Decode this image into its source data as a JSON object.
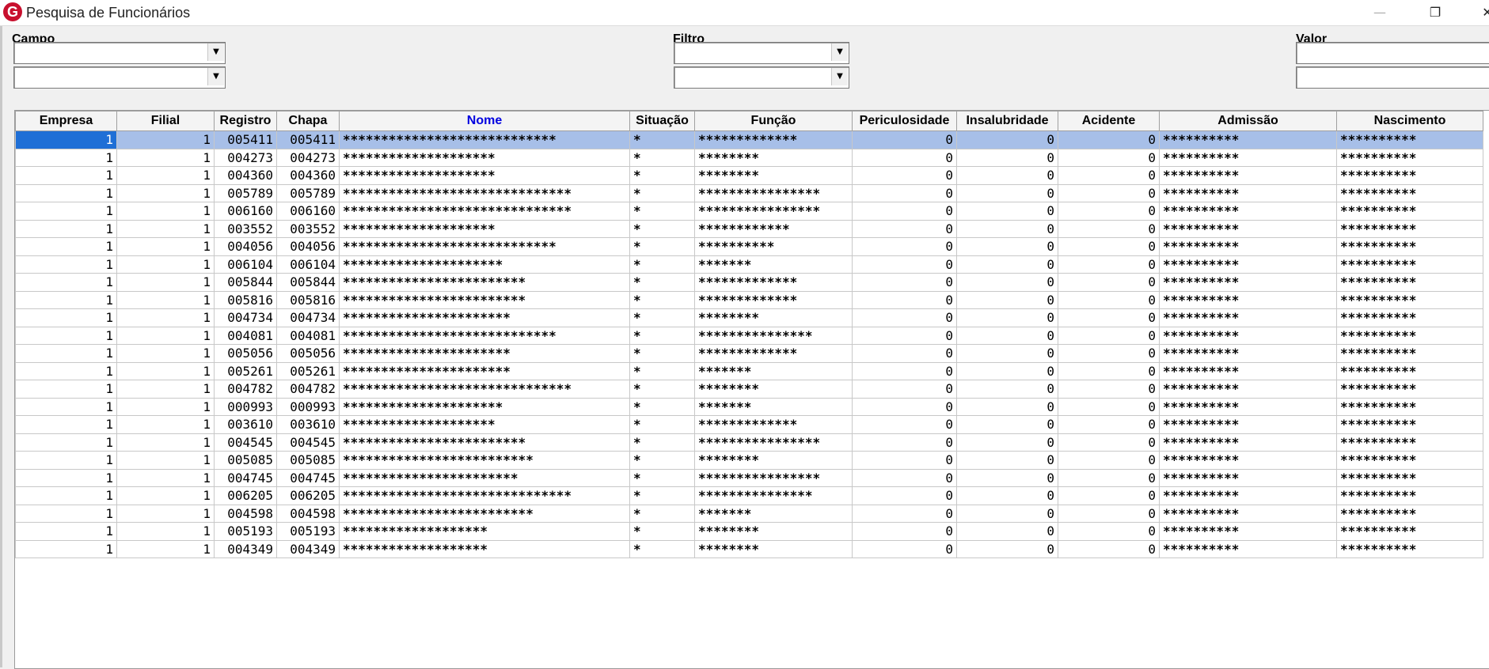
{
  "window": {
    "title": "Pesquisa de Funcionários",
    "logo_letter": "G"
  },
  "filters": {
    "campo_label": "Campo",
    "filtro_label": "Filtro",
    "valor_label": "Valor",
    "campo1_value": "",
    "campo2_value": "",
    "filtro1_value": "",
    "filtro2_value": "",
    "valor1_value": "",
    "valor2_value": ""
  },
  "table": {
    "columns": [
      "Empresa",
      "Filial",
      "Registro",
      "Chapa",
      "Nome",
      "Situação",
      "Função",
      "Periculosidade",
      "Insalubridade",
      "Acidente",
      "Admissão",
      "Nascimento"
    ],
    "sorted_column": "Nome",
    "selected_row": 0,
    "rows": [
      [
        "1",
        "1",
        "005411",
        "005411",
        "****************************",
        "*",
        "*************",
        "0",
        "0",
        "0",
        "**********",
        "**********"
      ],
      [
        "1",
        "1",
        "004273",
        "004273",
        "********************",
        "*",
        "********",
        "0",
        "0",
        "0",
        "**********",
        "**********"
      ],
      [
        "1",
        "1",
        "004360",
        "004360",
        "********************",
        "*",
        "********",
        "0",
        "0",
        "0",
        "**********",
        "**********"
      ],
      [
        "1",
        "1",
        "005789",
        "005789",
        "******************************",
        "*",
        "****************",
        "0",
        "0",
        "0",
        "**********",
        "**********"
      ],
      [
        "1",
        "1",
        "006160",
        "006160",
        "******************************",
        "*",
        "****************",
        "0",
        "0",
        "0",
        "**********",
        "**********"
      ],
      [
        "1",
        "1",
        "003552",
        "003552",
        "********************",
        "*",
        "************",
        "0",
        "0",
        "0",
        "**********",
        "**********"
      ],
      [
        "1",
        "1",
        "004056",
        "004056",
        "****************************",
        "*",
        "**********",
        "0",
        "0",
        "0",
        "**********",
        "**********"
      ],
      [
        "1",
        "1",
        "006104",
        "006104",
        "*********************",
        "*",
        "*******",
        "0",
        "0",
        "0",
        "**********",
        "**********"
      ],
      [
        "1",
        "1",
        "005844",
        "005844",
        "************************",
        "*",
        "*************",
        "0",
        "0",
        "0",
        "**********",
        "**********"
      ],
      [
        "1",
        "1",
        "005816",
        "005816",
        "************************",
        "*",
        "*************",
        "0",
        "0",
        "0",
        "**********",
        "**********"
      ],
      [
        "1",
        "1",
        "004734",
        "004734",
        "**********************",
        "*",
        "********",
        "0",
        "0",
        "0",
        "**********",
        "**********"
      ],
      [
        "1",
        "1",
        "004081",
        "004081",
        "****************************",
        "*",
        "***************",
        "0",
        "0",
        "0",
        "**********",
        "**********"
      ],
      [
        "1",
        "1",
        "005056",
        "005056",
        "**********************",
        "*",
        "*************",
        "0",
        "0",
        "0",
        "**********",
        "**********"
      ],
      [
        "1",
        "1",
        "005261",
        "005261",
        "**********************",
        "*",
        "*******",
        "0",
        "0",
        "0",
        "**********",
        "**********"
      ],
      [
        "1",
        "1",
        "004782",
        "004782",
        "******************************",
        "*",
        "********",
        "0",
        "0",
        "0",
        "**********",
        "**********"
      ],
      [
        "1",
        "1",
        "000993",
        "000993",
        "*********************",
        "*",
        "*******",
        "0",
        "0",
        "0",
        "**********",
        "**********"
      ],
      [
        "1",
        "1",
        "003610",
        "003610",
        "********************",
        "*",
        "*************",
        "0",
        "0",
        "0",
        "**********",
        "**********"
      ],
      [
        "1",
        "1",
        "004545",
        "004545",
        "************************",
        "*",
        "****************",
        "0",
        "0",
        "0",
        "**********",
        "**********"
      ],
      [
        "1",
        "1",
        "005085",
        "005085",
        "*************************",
        "*",
        "********",
        "0",
        "0",
        "0",
        "**********",
        "**********"
      ],
      [
        "1",
        "1",
        "004745",
        "004745",
        "***********************",
        "*",
        "****************",
        "0",
        "0",
        "0",
        "**********",
        "**********"
      ],
      [
        "1",
        "1",
        "006205",
        "006205",
        "******************************",
        "*",
        "***************",
        "0",
        "0",
        "0",
        "**********",
        "**********"
      ],
      [
        "1",
        "1",
        "004598",
        "004598",
        "*************************",
        "*",
        "*******",
        "0",
        "0",
        "0",
        "**********",
        "**********"
      ],
      [
        "1",
        "1",
        "005193",
        "005193",
        "*******************",
        "*",
        "********",
        "0",
        "0",
        "0",
        "**********",
        "**********"
      ],
      [
        "1",
        "1",
        "004349",
        "004349",
        "*******************",
        "*",
        "********",
        "0",
        "0",
        "0",
        "**********",
        "**********"
      ]
    ]
  }
}
